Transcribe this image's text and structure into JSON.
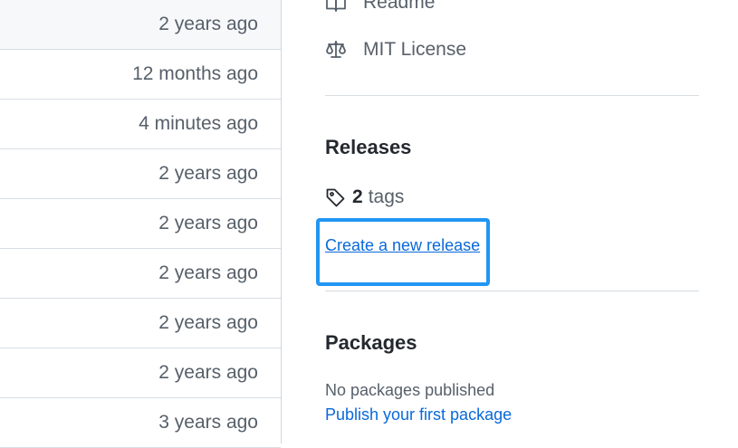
{
  "file_list": {
    "rows": [
      {
        "age": "2 years ago"
      },
      {
        "age": "12 months ago"
      },
      {
        "age": "4 minutes ago"
      },
      {
        "age": "2 years ago"
      },
      {
        "age": "2 years ago"
      },
      {
        "age": "2 years ago"
      },
      {
        "age": "2 years ago"
      },
      {
        "age": "2 years ago"
      },
      {
        "age": "3 years ago"
      }
    ]
  },
  "sidebar": {
    "readme_label": "Readme",
    "license_label": "MIT License",
    "releases": {
      "heading": "Releases",
      "tag_count": "2",
      "tag_label": "tags",
      "create_release_link": "Create a new release"
    },
    "packages": {
      "heading": "Packages",
      "empty_text": "No packages published",
      "publish_link": "Publish your first package"
    }
  },
  "colors": {
    "link": "#0969da",
    "highlight_border": "#2196f3",
    "muted_text": "#57606a"
  },
  "icons": {
    "readme": "book-icon",
    "license": "law-scale-icon",
    "tags": "tag-icon"
  }
}
